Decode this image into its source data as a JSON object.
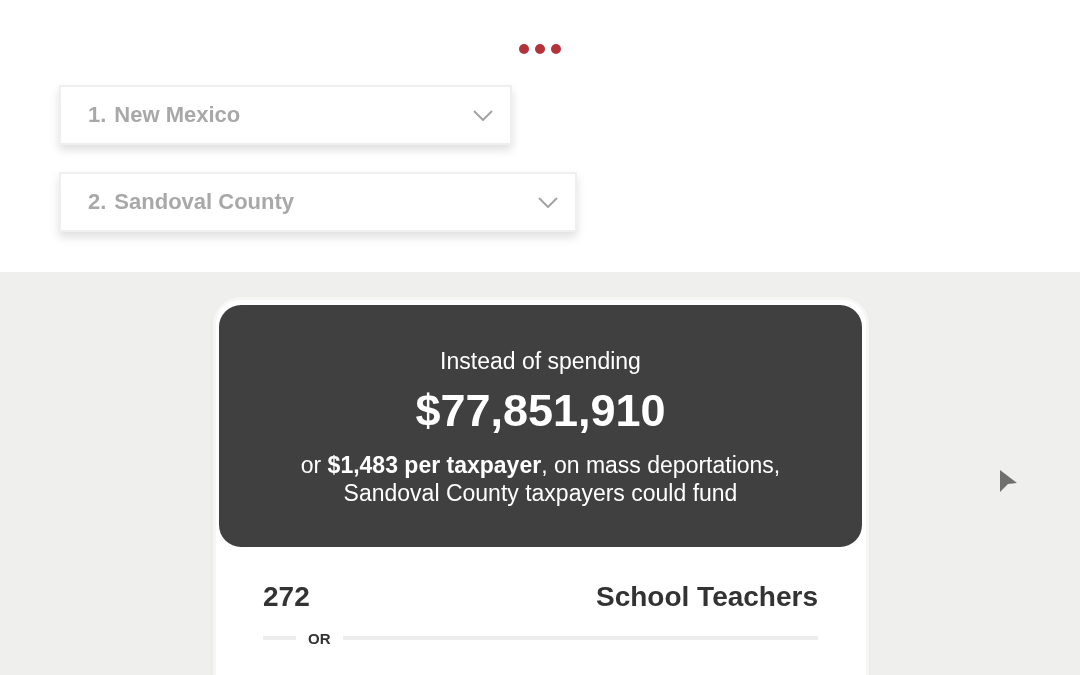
{
  "selectors": [
    {
      "number": "1.",
      "value": "New Mexico"
    },
    {
      "number": "2.",
      "value": "Sandoval County"
    }
  ],
  "card": {
    "intro": "Instead of spending",
    "amount": "$77,851,910",
    "description": "or **$1,483 per taxpayer**, on mass deportations, Sandoval County taxpayers could fund",
    "items": [
      {
        "count": "272",
        "label": "School Teachers",
        "separator": "OR"
      }
    ]
  }
}
